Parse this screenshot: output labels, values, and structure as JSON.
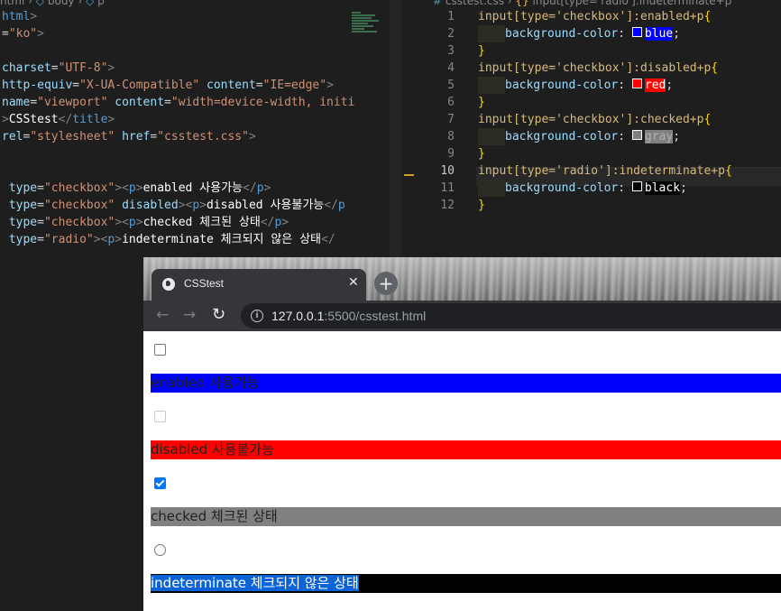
{
  "left_editor": {
    "breadcrumb": [
      "html",
      "body",
      "p"
    ],
    "lines": [
      [
        {
          "c": "tag",
          "t": "html"
        },
        {
          "c": "punc",
          "t": ">"
        }
      ],
      [
        {
          "c": "plain",
          "t": "="
        },
        {
          "c": "str",
          "t": "\"ko\""
        },
        {
          "c": "punc",
          "t": ">"
        }
      ],
      [],
      [
        {
          "c": "attr",
          "t": "charset"
        },
        {
          "c": "plain",
          "t": "="
        },
        {
          "c": "str",
          "t": "\"UTF-8\""
        },
        {
          "c": "punc",
          "t": ">"
        }
      ],
      [
        {
          "c": "attr",
          "t": "http-equiv"
        },
        {
          "c": "plain",
          "t": "="
        },
        {
          "c": "str",
          "t": "\"X-UA-Compatible\""
        },
        {
          "c": "plain",
          "t": " "
        },
        {
          "c": "attr",
          "t": "content"
        },
        {
          "c": "plain",
          "t": "="
        },
        {
          "c": "str",
          "t": "\"IE=edge\""
        },
        {
          "c": "punc",
          "t": ">"
        }
      ],
      [
        {
          "c": "attr",
          "t": "name"
        },
        {
          "c": "plain",
          "t": "="
        },
        {
          "c": "str",
          "t": "\"viewport\""
        },
        {
          "c": "plain",
          "t": " "
        },
        {
          "c": "attr",
          "t": "content"
        },
        {
          "c": "plain",
          "t": "="
        },
        {
          "c": "str",
          "t": "\"width=device-width, initi"
        }
      ],
      [
        {
          "c": "punc",
          "t": ">"
        },
        {
          "c": "txt",
          "t": "CSStest"
        },
        {
          "c": "punc",
          "t": "</"
        },
        {
          "c": "tag",
          "t": "title"
        },
        {
          "c": "punc",
          "t": ">"
        }
      ],
      [
        {
          "c": "attr",
          "t": "rel"
        },
        {
          "c": "plain",
          "t": "="
        },
        {
          "c": "str",
          "t": "\"stylesheet\""
        },
        {
          "c": "plain",
          "t": " "
        },
        {
          "c": "attr",
          "t": "href"
        },
        {
          "c": "plain",
          "t": "="
        },
        {
          "c": "str",
          "t": "\"csstest.css\""
        },
        {
          "c": "punc",
          "t": ">"
        }
      ],
      [],
      [],
      [
        {
          "c": "plain",
          "t": " "
        },
        {
          "c": "attr",
          "t": "type"
        },
        {
          "c": "plain",
          "t": "="
        },
        {
          "c": "str",
          "t": "\"checkbox\""
        },
        {
          "c": "punc",
          "t": "><"
        },
        {
          "c": "tag",
          "t": "p"
        },
        {
          "c": "punc",
          "t": ">"
        },
        {
          "c": "txt",
          "t": "enabled 사용가능"
        },
        {
          "c": "punc",
          "t": "</"
        },
        {
          "c": "tag",
          "t": "p"
        },
        {
          "c": "punc",
          "t": ">"
        }
      ],
      [
        {
          "c": "plain",
          "t": " "
        },
        {
          "c": "attr",
          "t": "type"
        },
        {
          "c": "plain",
          "t": "="
        },
        {
          "c": "str",
          "t": "\"checkbox\""
        },
        {
          "c": "plain",
          "t": " "
        },
        {
          "c": "attr",
          "t": "disabled"
        },
        {
          "c": "punc",
          "t": "><"
        },
        {
          "c": "tag",
          "t": "p"
        },
        {
          "c": "punc",
          "t": ">"
        },
        {
          "c": "txt",
          "t": "disabled 사용불가능"
        },
        {
          "c": "punc",
          "t": "</"
        },
        {
          "c": "tag",
          "t": "p"
        }
      ],
      [
        {
          "c": "plain",
          "t": " "
        },
        {
          "c": "attr",
          "t": "type"
        },
        {
          "c": "plain",
          "t": "="
        },
        {
          "c": "str",
          "t": "\"checkbox\""
        },
        {
          "c": "punc",
          "t": "><"
        },
        {
          "c": "tag",
          "t": "p"
        },
        {
          "c": "punc",
          "t": ">"
        },
        {
          "c": "txt",
          "t": "checked 체크된 상태"
        },
        {
          "c": "punc",
          "t": "</"
        },
        {
          "c": "tag",
          "t": "p"
        },
        {
          "c": "punc",
          "t": ">"
        }
      ],
      [
        {
          "c": "plain",
          "t": " "
        },
        {
          "c": "attr",
          "t": "type"
        },
        {
          "c": "plain",
          "t": "="
        },
        {
          "c": "str",
          "t": "\"radio\""
        },
        {
          "c": "punc",
          "t": "><"
        },
        {
          "c": "tag",
          "t": "p"
        },
        {
          "c": "punc",
          "t": ">"
        },
        {
          "c": "txt",
          "t": "indeterminate 체크되지 않은 상태"
        },
        {
          "c": "punc",
          "t": "</"
        }
      ]
    ]
  },
  "right_editor": {
    "breadcrumb": [
      "csstest.css",
      "input[type='radio']:indeterminate+p"
    ],
    "active_line": 10,
    "line_numbers": [
      "1",
      "2",
      "3",
      "4",
      "5",
      "6",
      "7",
      "8",
      "9",
      "10",
      "11",
      "12"
    ],
    "lines": [
      {
        "kind": "selector",
        "selector": "input[type='checkbox']:enabled+p",
        "brace": "{"
      },
      {
        "kind": "decl",
        "prop": "background-color",
        "value": "blue",
        "swatch": "#0000ff"
      },
      {
        "kind": "close",
        "brace": "}"
      },
      {
        "kind": "selector",
        "selector": "input[type='checkbox']:disabled+p",
        "brace": "{"
      },
      {
        "kind": "decl",
        "prop": "background-color",
        "value": "red",
        "swatch": "#ff0000"
      },
      {
        "kind": "close",
        "brace": "}"
      },
      {
        "kind": "selector",
        "selector": "input[type='checkbox']:checked+p",
        "brace": "{"
      },
      {
        "kind": "decl",
        "prop": "background-color",
        "value": "gray",
        "swatch": "#808080"
      },
      {
        "kind": "close",
        "brace": "}"
      },
      {
        "kind": "selector",
        "selector": "input[type='radio']:indeterminate+p",
        "brace": "{"
      },
      {
        "kind": "decl",
        "prop": "background-color",
        "value": "black",
        "swatch": "#000000"
      },
      {
        "kind": "close",
        "brace": "}"
      }
    ]
  },
  "browser": {
    "tab_title": "CSStest",
    "url_host": "127.0.0.1",
    "url_rest": ":5500/csstest.html",
    "items": [
      {
        "control": "checkbox",
        "state": "enabled",
        "label": "enabled 사용가능",
        "bg": "#0000ff"
      },
      {
        "control": "checkbox",
        "state": "disabled",
        "label": "disabled 사용불가능",
        "bg": "#ff0000"
      },
      {
        "control": "checkbox",
        "state": "checked",
        "label": "checked 체크된 상태",
        "bg": "#808080"
      },
      {
        "control": "radio",
        "state": "indeterminate",
        "label": "indeterminate 체크되지 않은 상태",
        "bg": "#000000",
        "selected_text": true
      }
    ]
  }
}
